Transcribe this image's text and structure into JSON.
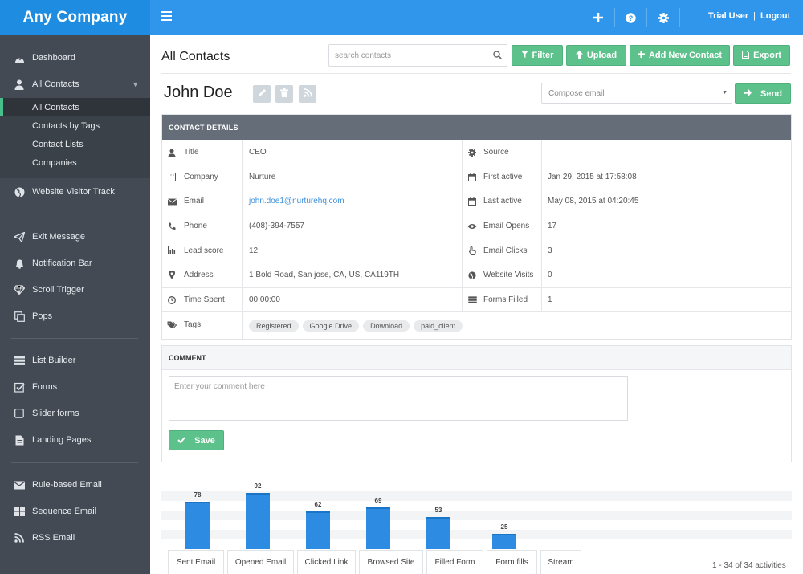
{
  "brand": "Any Company",
  "topbar": {
    "user": "Trial User",
    "logout": "Logout"
  },
  "sidebar": {
    "dashboard": "Dashboard",
    "all_contacts": "All Contacts",
    "sub": [
      "All Contacts",
      "Contacts by Tags",
      "Contact Lists",
      "Companies"
    ],
    "website_visitor_track": "Website Visitor Track",
    "group2": [
      "Exit Message",
      "Notification Bar",
      "Scroll Trigger",
      "Pops"
    ],
    "group3": [
      "List Builder",
      "Forms",
      "Slider forms",
      "Landing Pages"
    ],
    "group4": [
      "Rule-based Email",
      "Sequence Email",
      "RSS Email"
    ]
  },
  "header": {
    "title": "All Contacts",
    "search_placeholder": "search contacts",
    "buttons": {
      "filter": "Filter",
      "upload": "Upload",
      "add": "Add New Contact",
      "export": "Export"
    }
  },
  "contact": {
    "name": "John Doe",
    "compose_placeholder": "Compose email",
    "send": "Send"
  },
  "details": {
    "heading": "CONTACT DETAILS",
    "left": [
      {
        "label": "Title",
        "value": "CEO"
      },
      {
        "label": "Company",
        "value": "Nurture"
      },
      {
        "label": "Email",
        "value": "john.doe1@nurturehq.com"
      },
      {
        "label": "Phone",
        "value": "(408)-394-7557"
      },
      {
        "label": "Lead score",
        "value": "12"
      },
      {
        "label": "Address",
        "value": "1 Bold Road, San jose, CA, US, CA119TH"
      },
      {
        "label": "Time Spent",
        "value": "00:00:00"
      }
    ],
    "right": [
      {
        "label": "Source",
        "value": ""
      },
      {
        "label": "First active",
        "value": "Jan 29, 2015 at 17:58:08"
      },
      {
        "label": "Last active",
        "value": "May 08, 2015 at 04:20:45"
      },
      {
        "label": "Email Opens",
        "value": "17"
      },
      {
        "label": "Email Clicks",
        "value": "3"
      },
      {
        "label": "Website Visits",
        "value": "0"
      },
      {
        "label": "Forms Filled",
        "value": "1"
      }
    ],
    "tags_label": "Tags",
    "tags": [
      "Registered",
      "Google Drive",
      "Download",
      "paid_client"
    ]
  },
  "comment": {
    "heading": "COMMENT",
    "placeholder": "Enter your comment here",
    "save": "Save"
  },
  "chart_data": {
    "type": "bar",
    "categories": [
      "Sent Email",
      "Opened Email",
      "Clicked Link",
      "Browsed Site",
      "Filled Form",
      "Form fills"
    ],
    "values": [
      78,
      92,
      62,
      69,
      53,
      25
    ]
  },
  "tabs": [
    "Sent Email",
    "Opened Email",
    "Clicked Link",
    "Browsed Site",
    "Filled Form",
    "Form fills",
    "Stream"
  ],
  "pager": "1 - 34 of 34 activities",
  "colors": {
    "brand": "#1e8ce0",
    "topbar": "#2f96ec",
    "sidebar": "#434a54",
    "green": "#5cc18a",
    "bar": "#2d8ce1"
  }
}
